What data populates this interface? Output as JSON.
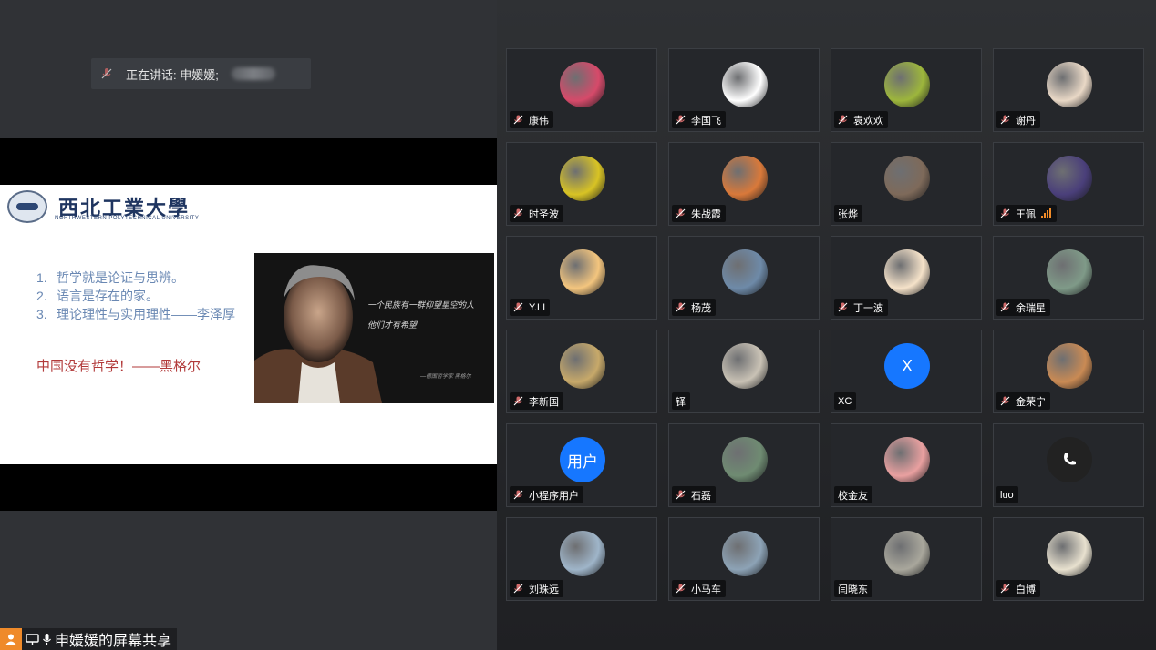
{
  "speaking": {
    "label": "正在讲话: 申媛媛;"
  },
  "slide": {
    "logo_cn": "西北工業大學",
    "logo_en": "NORTHWESTERN POLYTECHNICAL UNIVERSITY",
    "points": [
      {
        "num": "1.",
        "text": "哲学就是论证与思辨。"
      },
      {
        "num": "2.",
        "text": "语言是存在的家。"
      },
      {
        "num": "3.",
        "text": "理论理性与实用理性——李泽厚"
      }
    ],
    "quote": "中国没有哲学！——黑格尔",
    "portrait_text_1": "一个民族有一群仰望星空的人",
    "portrait_text_2": "他们才有希望",
    "portrait_signature": "—德国哲学家 黑格尔"
  },
  "share_label": "申媛媛的屏幕共享",
  "participants": [
    {
      "name": "康伟",
      "muted": true,
      "avatar": "roses-photo",
      "bg": "#d64a6a"
    },
    {
      "name": "李国飞",
      "muted": true,
      "avatar": "bird-logo",
      "bg": "#ffffff"
    },
    {
      "name": "袁欢欢",
      "muted": true,
      "avatar": "flower-photo",
      "bg": "#9db63c"
    },
    {
      "name": "谢丹",
      "muted": true,
      "avatar": "portrait-photo",
      "bg": "#e9d8c6"
    },
    {
      "name": "时圣波",
      "muted": true,
      "avatar": "football-photo",
      "bg": "#d8c324"
    },
    {
      "name": "朱战霞",
      "muted": true,
      "avatar": "sunset-photo",
      "bg": "#d9793a"
    },
    {
      "name": "张烨",
      "muted": false,
      "avatar": "figurine-photo",
      "bg": "#7e6a5a"
    },
    {
      "name": "王佩",
      "muted": true,
      "avatar": "crowd-photo",
      "bg": "#4a3f7a",
      "signal": true
    },
    {
      "name": "Y.LI",
      "muted": true,
      "avatar": "cartoon-girl",
      "bg": "#f3c57e"
    },
    {
      "name": "杨茂",
      "muted": true,
      "avatar": "man-photo",
      "bg": "#6e8aa8"
    },
    {
      "name": "丁一波",
      "muted": true,
      "avatar": "cartoon-girl-2",
      "bg": "#f5e2c9"
    },
    {
      "name": "余瑞星",
      "muted": true,
      "avatar": "park-photo",
      "bg": "#7f9a88"
    },
    {
      "name": "李新国",
      "muted": true,
      "avatar": "beach-photo",
      "bg": "#c7a96a"
    },
    {
      "name": "铎",
      "muted": false,
      "avatar": "office-photo",
      "bg": "#c9c2b5"
    },
    {
      "name": "XC",
      "muted": false,
      "avatar": "letter-x",
      "bg": "#1677ff",
      "letter": "X"
    },
    {
      "name": "金荣宁",
      "muted": true,
      "avatar": "cat-photo",
      "bg": "#c98a54"
    },
    {
      "name": "小程序用户",
      "muted": true,
      "avatar": "text-avatar",
      "bg": "#1677ff",
      "letter": "用户"
    },
    {
      "name": "石磊",
      "muted": true,
      "avatar": "river-photo",
      "bg": "#6f8b72"
    },
    {
      "name": "校金友",
      "muted": false,
      "avatar": "cartoon-kids",
      "bg": "#e9a0a0"
    },
    {
      "name": "luo",
      "muted": false,
      "avatar": "phone-icon",
      "bg": "#222222",
      "phone": true
    },
    {
      "name": "刘珠远",
      "muted": true,
      "avatar": "harbor-photo",
      "bg": "#9fb5c9"
    },
    {
      "name": "小马车",
      "muted": true,
      "avatar": "lake-photo",
      "bg": "#8da3b6"
    },
    {
      "name": "闫晓东",
      "muted": false,
      "avatar": "bridge-photo",
      "bg": "#a9a79c"
    },
    {
      "name": "白博",
      "muted": true,
      "avatar": "painting-photo",
      "bg": "#e8e1cf"
    }
  ]
}
